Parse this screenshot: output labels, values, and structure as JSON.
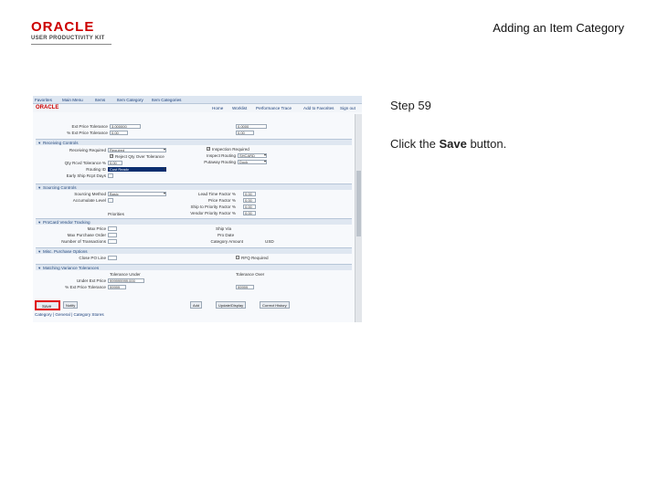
{
  "slide": {
    "logo_text": "ORACLE",
    "logo_subtitle": "USER PRODUCTIVITY KIT",
    "title": "Adding an Item Category",
    "step": "Step 59",
    "instruction_prefix": "Click the ",
    "instruction_bold": "Save",
    "instruction_suffix": " button."
  },
  "colors": {
    "brand": "#cc0000",
    "highlight": "#e00000",
    "section_bar": "#dfe7f1"
  },
  "screenshot": {
    "breadcrumb": [
      "Favorites",
      "Main Menu",
      "Items",
      "Item Category",
      "Item Categories"
    ],
    "nav_links": [
      "Home",
      "Worklist",
      "Performance Trace",
      "Add to Favorites",
      "Sign out"
    ],
    "top_fields": {
      "upper_label": "Ext Price Tolerance",
      "upper_value": "3.000000",
      "upper_right_value": "0.0000",
      "lower_label": "% Ext Price Tolerance",
      "lower_value": "0.00",
      "lower_right_value": "0.00"
    },
    "receiving": {
      "title": "Receiving Controls",
      "receiving_label": "Receiving Required",
      "receiving_value": "Required",
      "reject_label": "Reject Qty Over Tolerance",
      "qty_tol_label": "Qty Rcvd Tolerance %",
      "qty_tol_value": "0.00",
      "routing_label": "Routing ID",
      "routing_value": "Cust Ready",
      "early_label": "Early Ship Rcpt Days",
      "inspect_label": "Inspection Required",
      "insp_routing_label": "Inspect Routing",
      "insp_routing_value": "SHCARD",
      "putaway_label": "Putaway Routing",
      "putaway_value": "Dock"
    },
    "sourcing": {
      "title": "Sourcing Controls",
      "method_label": "Sourcing Method",
      "method_value": "Basic",
      "level_label": "Accumulate Level",
      "priorities": "Priorities",
      "lead_label": "Lead Time Factor %",
      "lead_value": "0.00",
      "price_label": "Price Factor %",
      "price_value": "0.00",
      "ship_label": "Ship to Priority Factor %",
      "ship_value": "0.00",
      "vendor_label": "Vendor Priority Factor %",
      "vendor_value": "0.00"
    },
    "procard": {
      "title": "ProCard Vendor Tracking",
      "max_label": "Max Price",
      "max_value": "",
      "maxpo_label": "Max Purchase Order",
      "num_label": "Number of Transactions",
      "ship_via": "Ship Via",
      "pro_date": "Pro Date",
      "category_label": "Category Amount",
      "category_value": "USD"
    },
    "misc": {
      "title": "Misc. Purchase Options",
      "close_label": "Close PO Line",
      "rfq_label": "RFQ Required"
    },
    "matching": {
      "title": "Matching Variance Tolerances",
      "under_label": "Under Ext Price",
      "under_value": "999999999.000",
      "pct_label": "% Ext Price Tolerance",
      "pct_value": "99999",
      "col1_header": "Tolerance Under",
      "col2_header": "Tolerance Over",
      "right_value": "99999"
    },
    "buttons": {
      "save": "Save",
      "notify": "Notify",
      "add": "Add",
      "update": "Update/Display",
      "correct": "Correct History"
    },
    "footer_links": "Category | General | Category Stores"
  }
}
